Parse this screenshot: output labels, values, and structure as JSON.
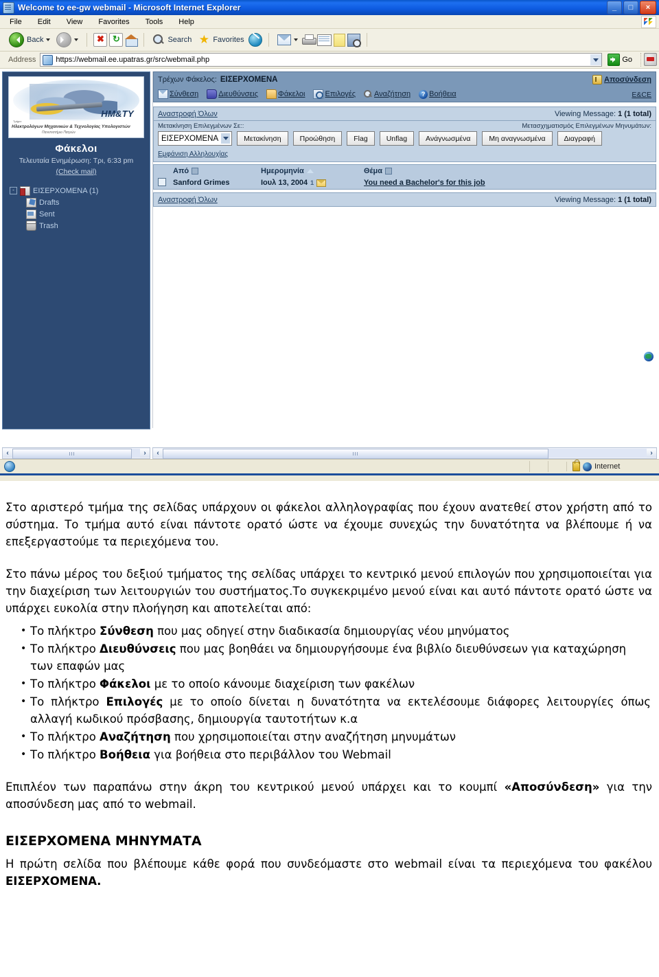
{
  "browser": {
    "window_title": "Welcome to ee-gw webmail - Microsoft Internet Explorer",
    "window_buttons": {
      "minimize": "_",
      "maximize": "□",
      "close": "×"
    },
    "menu": [
      "File",
      "Edit",
      "View",
      "Favorites",
      "Tools",
      "Help"
    ],
    "toolbar": {
      "back_label": "Back",
      "search_label": "Search",
      "favorites_label": "Favorites"
    },
    "address": {
      "label": "Address",
      "url": "https://webmail.ee.upatras.gr/src/webmail.php",
      "go_label": "Go"
    },
    "status": {
      "zone": "Internet"
    }
  },
  "sidebar": {
    "logo": {
      "initials": "HM&TY",
      "line1": "Tμήμα:",
      "line2": "Ηλεκτρολόγων Μηχανικών & Τεχνολογίας Υπολογιστών",
      "line3": "Πανεπιστήμιο Πατρών"
    },
    "title": "Φάκελοι",
    "last_update": "Τελευταία Ενημέρωση: Τρι, 6:33 pm",
    "check_mail": "(Check mail)",
    "folders": [
      {
        "label": "ΕΙΣΕΡΧΟΜΕΝΑ (1)",
        "icon": "inbox-icon",
        "expander": "-",
        "child": false
      },
      {
        "label": "Drafts",
        "icon": "drafts-icon",
        "child": true
      },
      {
        "label": "Sent",
        "icon": "sent-icon",
        "child": true
      },
      {
        "label": "Trash",
        "icon": "trash-icon",
        "child": true
      }
    ]
  },
  "webmail": {
    "current_folder_label": "Τρέχων Φάκελος:",
    "current_folder_value": "ΕΙΣΕΡΧΟΜΕΝΑ",
    "logout": "Αποσύνδεση",
    "nav": [
      {
        "label": "Σύνθεση",
        "icon": "compose-icon"
      },
      {
        "label": "Διευθύνσεις",
        "icon": "addressbook-icon"
      },
      {
        "label": "Φάκελοι",
        "icon": "folders-icon"
      },
      {
        "label": "Επιλογές",
        "icon": "options-icon"
      },
      {
        "label": "Αναζήτηση",
        "icon": "search-icon"
      },
      {
        "label": "Βοήθεια",
        "icon": "help-icon"
      }
    ],
    "ebce": "E&CE",
    "toggle_all": "Αναστροφή Όλων",
    "viewing_label": "Viewing Message:",
    "viewing_value": "1 (1 total)",
    "move_label": "Μετακίνηση Επιλεγμένων Σε::",
    "transform_label": "Μετασχηματισμός Επιλεγμένων Μηνυμάτων:",
    "folder_select_value": "ΕΙΣΕΡΧΟΜΕΝΑ",
    "buttons": [
      "Μετακίνηση",
      "Προώθηση",
      "Flag",
      "Unflag",
      "Ανάγνωσμένα",
      "Μη αναγνωσμένα",
      "Διαγραφή"
    ],
    "show_thread": "Εμφάνιση Αλληλουχίας",
    "columns": {
      "from": "Από",
      "date": "Ημερομηνία",
      "subject": "Θέμα"
    },
    "messages": [
      {
        "from": "Sanford Grimes",
        "date": "Ιουλ 13, 2004",
        "attach": "1",
        "subject": "You need a Bachelor's for this job"
      }
    ]
  },
  "document": {
    "p1": "Στο αριστερό τμήμα της σελίδας υπάρχουν οι φάκελοι αλληλογραφίας που έχουν ανατεθεί στον χρήστη από το σύστημα. Το τμήμα αυτό είναι πάντοτε ορατό ώστε να έχουμε συνεχώς την δυνατότητα να βλέπουμε ή να επεξεργαστούμε τα περιεχόμενα του.",
    "p2": "Στο πάνω μέρος του δεξιού τμήματος της σελίδας υπάρχει το κεντρικό μενού επιλογών που χρησιμοποιείται για την διαχείριση των λειτουργιών του συστήματος.Το συγκεκριμένο μενού είναι και αυτό πάντοτε ορατό ώστε να υπάρχει ευκολία στην πλοήγηση και αποτελείται από:",
    "bullets": [
      {
        "pre": "Το πλήκτρο ",
        "bold": "Σύνθεση",
        "post": " που μας οδηγεί στην διαδικασία δημιουργίας νέου μηνύματος"
      },
      {
        "pre": "Το πλήκτρο ",
        "bold": "Διευθύνσεις",
        "post": " που μας βοηθάει να δημιουργήσουμε ένα βιβλίο διευθύνσεων για καταχώρηση των επαφών μας"
      },
      {
        "pre": "Το πλήκτρο ",
        "bold": "Φάκελοι",
        "post": " με το οποίο κάνουμε διαχείριση των φακέλων"
      },
      {
        "pre": "Το πλήκτρο ",
        "bold": "Επιλογές",
        "post": " με το οποίο δίνεται η δυνατότητα να εκτελέσουμε διάφορες λειτουργίες όπως αλλαγή κωδικού πρόσβασης, δημιουργία ταυτοτήτων κ.α"
      },
      {
        "pre": "Το πλήκτρο ",
        "bold": "Αναζήτηση",
        "post": " που χρησιμοποιείται στην αναζήτηση μηνυμάτων"
      },
      {
        "pre": "Το πλήκτρο ",
        "bold": "Βοήθεια",
        "post": " για βοήθεια στο περιβάλλον του Webmail"
      }
    ],
    "p3_pre": "Επιπλέον των παραπάνω στην άκρη του κεντρικού μενού υπάρχει και το κουμπί ",
    "p3_bold": "«Αποσύνδεση»",
    "p3_post": " για την αποσύνδεση μας από το webmail.",
    "heading": "ΕΙΣΕΡΧΟΜΕΝΑ ΜΗΝΥΜΑΤΑ",
    "p4_pre": "Η πρώτη σελίδα που βλέπουμε κάθε φορά που συνδεόμαστε στο webmail είναι τα περιεχόμενα του φακέλου ",
    "p4_bold": "ΕΙΣΕΡΧΟΜΕΝΑ."
  }
}
